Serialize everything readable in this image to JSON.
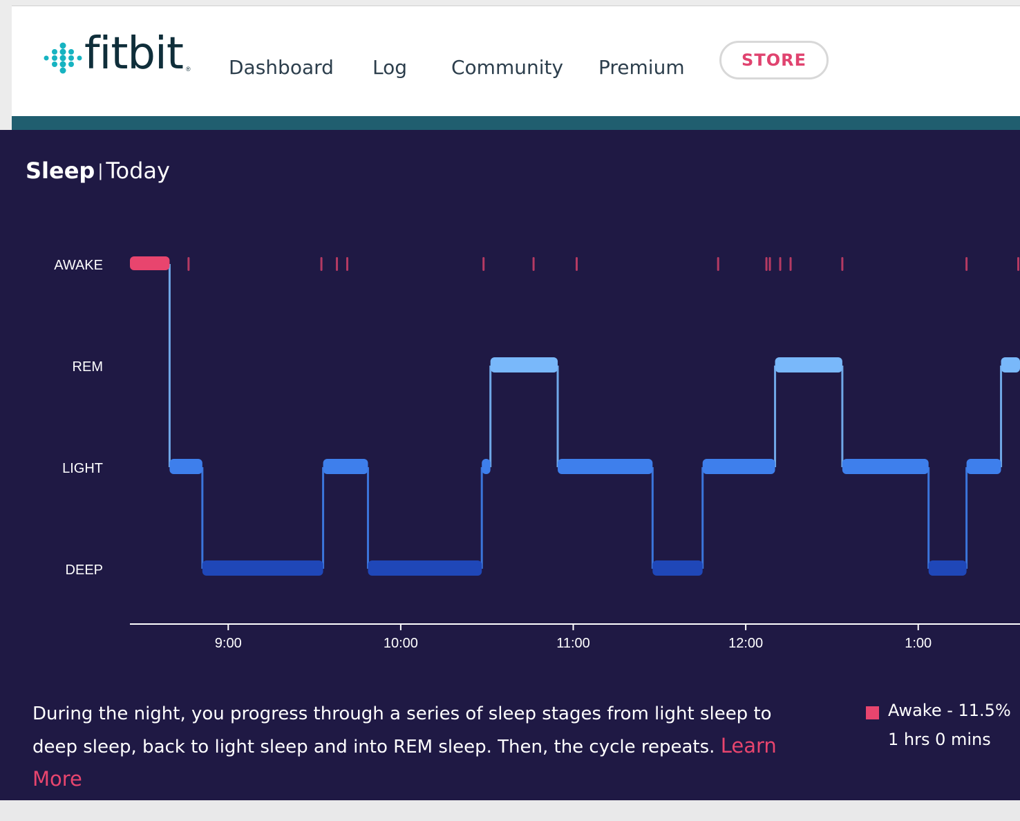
{
  "brand": {
    "name": "fitbit",
    "dot_color": "#17b3c1"
  },
  "nav": {
    "items": [
      {
        "label": "Dashboard"
      },
      {
        "label": "Log"
      },
      {
        "label": "Community"
      },
      {
        "label": "Premium"
      }
    ],
    "store_label": "STORE"
  },
  "sleep": {
    "title": "Sleep",
    "separator": "|",
    "period": "Today",
    "description": "During the night, you progress through a series of sleep stages from light sleep to deep sleep, back to light sleep and into REM sleep. Then, the cycle repeats.",
    "learn_more": "Learn More",
    "legend": {
      "label": "Awake - 11.5%",
      "duration": "1 hrs 0 mins",
      "color": "#e8456e"
    }
  },
  "colors": {
    "panel_bg": "#1f1944",
    "awake": "#e8456e",
    "rem": "#79b8fa",
    "light": "#3e7fec",
    "deep": "#1f47b8"
  },
  "chart_data": {
    "type": "step",
    "y_categories": [
      "AWAKE",
      "REM",
      "LIGHT",
      "DEEP"
    ],
    "x_tick_labels": [
      "9:00",
      "10:00",
      "11:00",
      "12:00",
      "1:00"
    ],
    "x_ticks_hours": [
      21,
      22,
      23,
      24,
      25
    ],
    "xlim_hours": [
      20.43,
      25.59
    ],
    "segments": [
      {
        "stage": "AWAKE",
        "start": 20.43,
        "end": 20.66
      },
      {
        "stage": "LIGHT",
        "start": 20.66,
        "end": 20.85
      },
      {
        "stage": "DEEP",
        "start": 20.85,
        "end": 21.55
      },
      {
        "stage": "LIGHT",
        "start": 21.55,
        "end": 21.81
      },
      {
        "stage": "DEEP",
        "start": 21.81,
        "end": 22.47
      },
      {
        "stage": "LIGHT",
        "start": 22.47,
        "end": 22.52
      },
      {
        "stage": "REM",
        "start": 22.52,
        "end": 22.91
      },
      {
        "stage": "LIGHT",
        "start": 22.91,
        "end": 23.46
      },
      {
        "stage": "DEEP",
        "start": 23.46,
        "end": 23.75
      },
      {
        "stage": "LIGHT",
        "start": 23.75,
        "end": 24.17
      },
      {
        "stage": "REM",
        "start": 24.17,
        "end": 24.56
      },
      {
        "stage": "LIGHT",
        "start": 24.56,
        "end": 25.06
      },
      {
        "stage": "DEEP",
        "start": 25.06,
        "end": 25.28
      },
      {
        "stage": "LIGHT",
        "start": 25.28,
        "end": 25.48
      },
      {
        "stage": "REM",
        "start": 25.48,
        "end": 25.59
      }
    ],
    "awake_marks": [
      20.77,
      21.54,
      21.63,
      21.69,
      22.48,
      22.77,
      23.02,
      23.84,
      24.12,
      24.14,
      24.2,
      24.26,
      24.56,
      25.28,
      25.58
    ]
  }
}
